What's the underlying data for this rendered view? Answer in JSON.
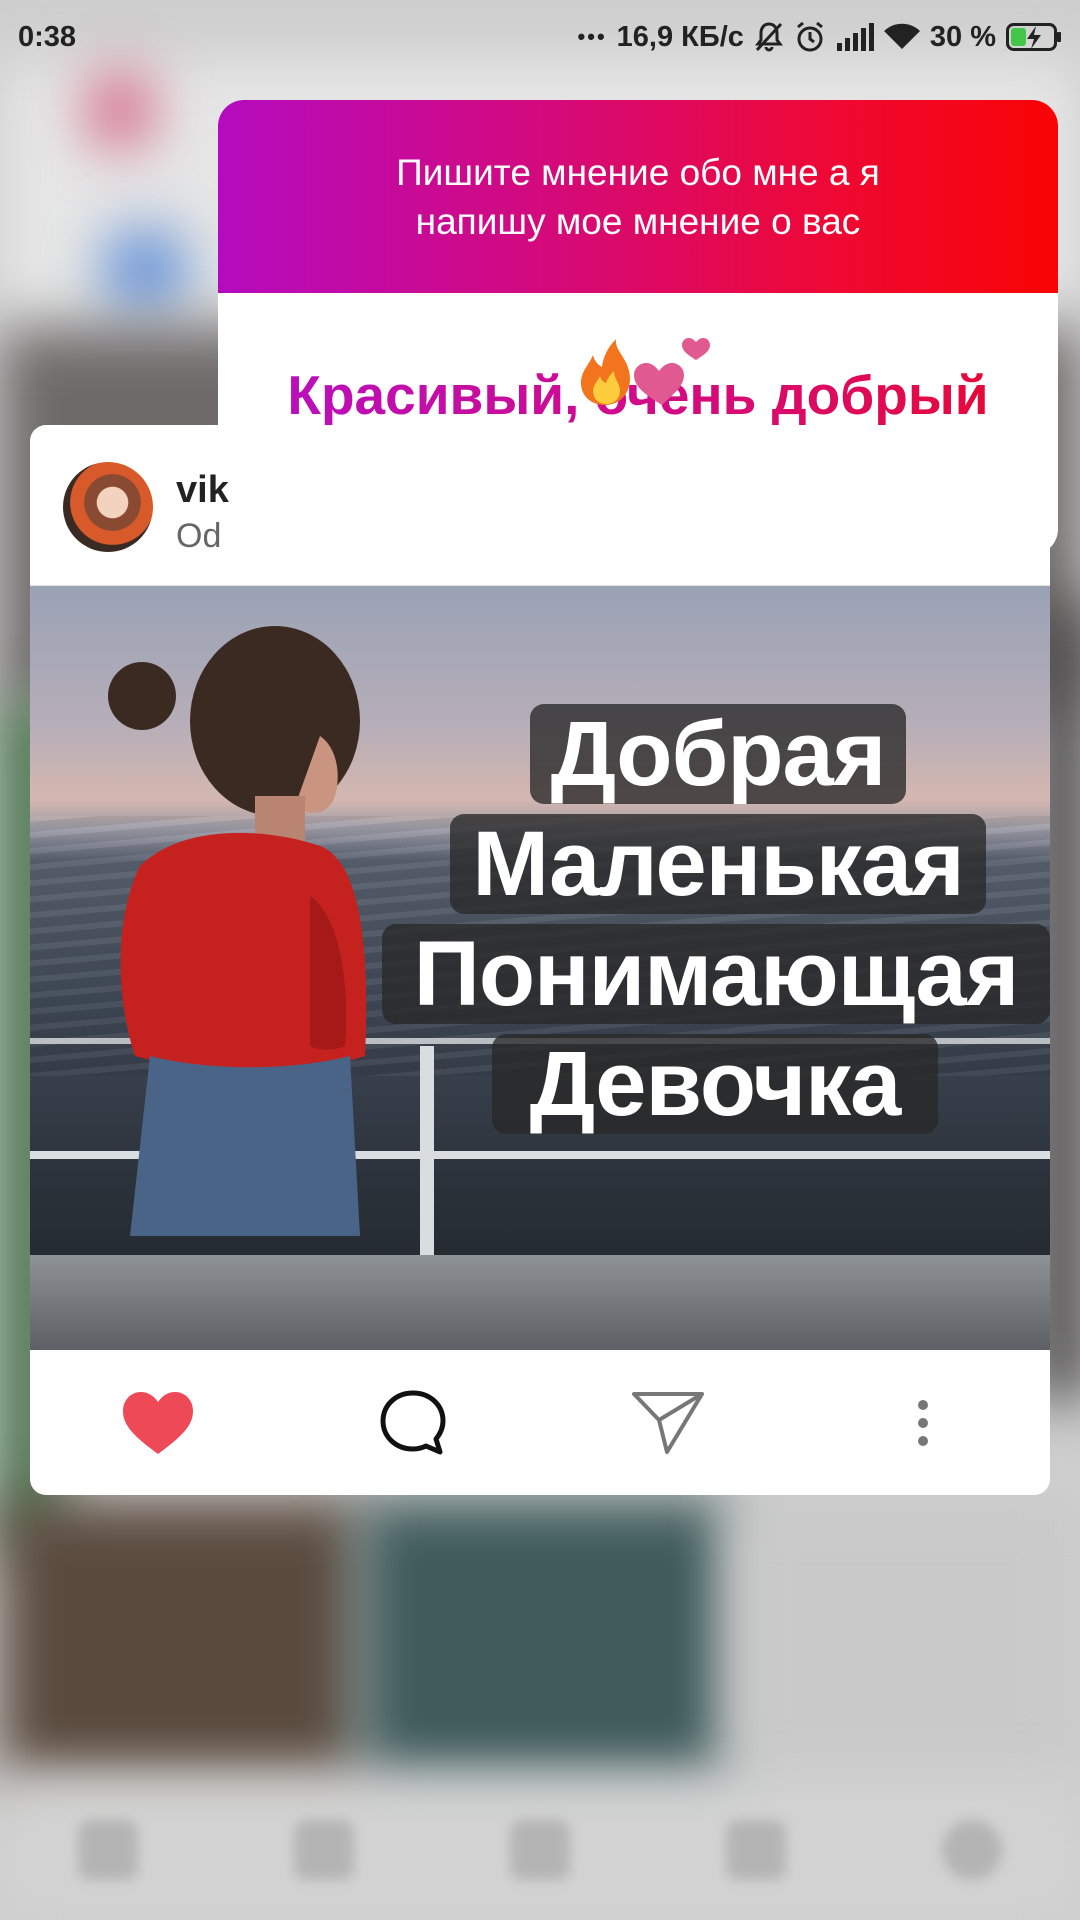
{
  "status_bar": {
    "time": "0:38",
    "dots": "•••",
    "network_speed": "16,9 КБ/с",
    "battery": "30 %"
  },
  "story_question": {
    "prompt": "Пишите мнение обо мне а я\nнапишу мое мнение о вас",
    "answer": "Красивый, очень добрый",
    "answer_emoji": [
      "fire-icon",
      "two-hearts-icon"
    ],
    "gradient_colors": [
      "#b40bbf",
      "#f80404"
    ]
  },
  "post": {
    "username": "vik",
    "subtitle": "Od",
    "overlay_lines": [
      "Добрая",
      "Маленькая",
      "Понимающая",
      "Девочка"
    ],
    "actions": [
      "like-heart-icon",
      "comment-icon",
      "share-icon",
      "more-icon"
    ],
    "like_color": "#ed4956"
  }
}
